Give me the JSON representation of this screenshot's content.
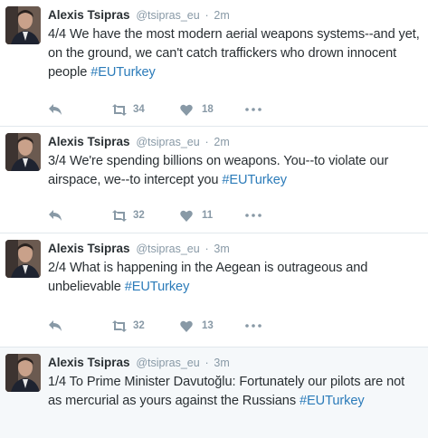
{
  "tweets": [
    {
      "name": "Alexis Tsipras",
      "handle": "@tsipras_eu",
      "separator": "·",
      "time": "2m",
      "text_before": "4/4 We have the most modern aerial weapons systems--and yet, on the ground, we can't catch traffickers who drown innocent people ",
      "hashtag": "#EUTurkey",
      "retweets": "34",
      "likes": "18"
    },
    {
      "name": "Alexis Tsipras",
      "handle": "@tsipras_eu",
      "separator": "·",
      "time": "2m",
      "text_before": "3/4 We're spending billions on weapons. You--to violate our airspace, we--to intercept you ",
      "hashtag": "#EUTurkey",
      "retweets": "32",
      "likes": "11"
    },
    {
      "name": "Alexis Tsipras",
      "handle": "@tsipras_eu",
      "separator": "·",
      "time": "3m",
      "text_before": "2/4 What is happening in the Aegean is outrageous and unbelievable ",
      "hashtag": "#EUTurkey",
      "retweets": "32",
      "likes": "13"
    },
    {
      "name": "Alexis Tsipras",
      "handle": "@tsipras_eu",
      "separator": "·",
      "time": "3m",
      "text_before": "1/4 To Prime Minister Davutoğlu: Fortunately our pilots are not as mercurial as yours against the Russians ",
      "hashtag": "#EUTurkey"
    }
  ],
  "colors": {
    "text": "#292f33",
    "muted": "#8899a6",
    "link": "#2b7bb9",
    "highlight_bg": "#f5f8fa",
    "divider": "#e1e8ed"
  },
  "icons": [
    "reply-icon",
    "retweet-icon",
    "like-icon",
    "more-icon"
  ]
}
